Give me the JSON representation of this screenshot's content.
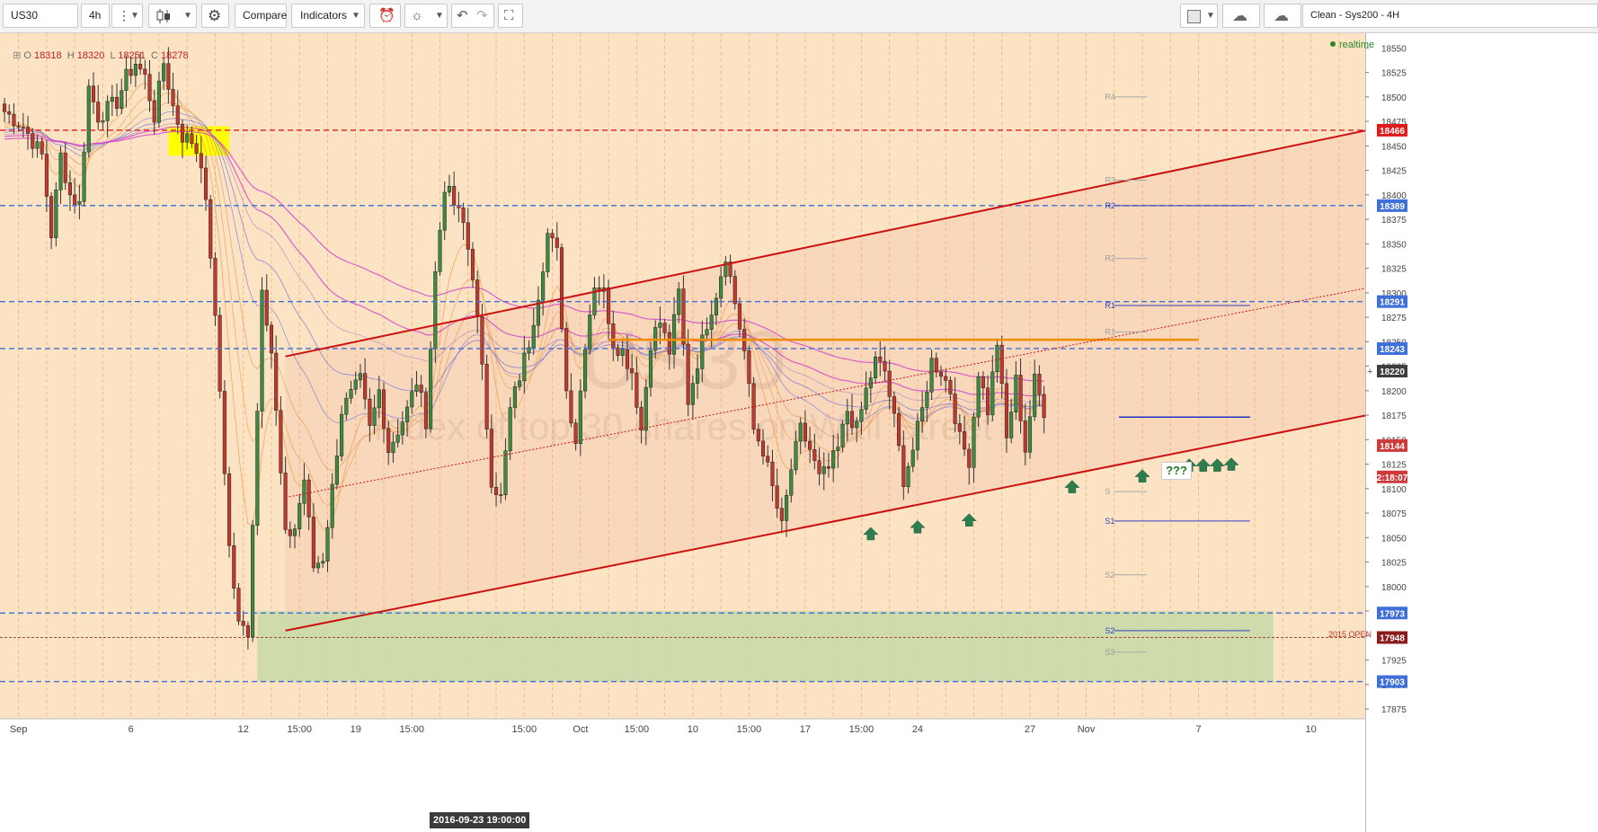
{
  "toolbar": {
    "symbol": "US30",
    "interval": "4h",
    "compare_label": "Compare",
    "indicators_label": "Indicators",
    "template_label": "Clean - Sys200 - 4H",
    "icons": [
      "menu-dots-icon",
      "candlestick-icon",
      "gear-icon",
      "alert-icon",
      "lightbulb-icon",
      "undo-icon",
      "redo-icon",
      "fullscreen-icon",
      "rectangle-icon",
      "cloud-down-icon",
      "cloud-up-icon"
    ]
  },
  "legend": {
    "o_label": "O",
    "o": "18318",
    "h_label": "H",
    "h": "18320",
    "l_label": "L",
    "l": "18251",
    "c_label": "C",
    "c": "18278"
  },
  "status": {
    "realtime": "realtime"
  },
  "watermark": {
    "title": "US30",
    "subtitle": "Index of top 30 shares on Wall Street"
  },
  "price_axis": {
    "ticks": [
      "18550",
      "18525",
      "18500",
      "18475",
      "18450",
      "18425",
      "18400",
      "18375",
      "18350",
      "18325",
      "18300",
      "18275",
      "18250",
      "18225",
      "18200",
      "18175",
      "18150",
      "18125",
      "18100",
      "18075",
      "18050",
      "18025",
      "18000",
      "17975",
      "17950",
      "17925",
      "17900",
      "17875"
    ],
    "badges": [
      {
        "price": 18466,
        "label": "18466",
        "color": "#e01b1b"
      },
      {
        "price": 18389,
        "label": "18389",
        "color": "#3f6fd8"
      },
      {
        "price": 18291,
        "label": "18291",
        "color": "#3f6fd8"
      },
      {
        "price": 18243,
        "label": "18243",
        "color": "#3f6fd8"
      },
      {
        "price": 18220,
        "label": "18220",
        "color": "#3d3d3d"
      },
      {
        "price": 18144,
        "label": "18144",
        "color": "#cf3a3a"
      },
      {
        "price": 18112,
        "label": "2:18:07",
        "color": "#cf3a3a"
      },
      {
        "price": 17973,
        "label": "17973",
        "color": "#3f6fd8"
      },
      {
        "price": 17948,
        "label": "17948",
        "color": "#8b1a1a"
      },
      {
        "price": 17903,
        "label": "17903",
        "color": "#3f6fd8"
      }
    ]
  },
  "time_axis": {
    "labels": [
      {
        "bar": 3,
        "label": "Sep"
      },
      {
        "bar": 27,
        "label": "6"
      },
      {
        "bar": 51,
        "label": "12"
      },
      {
        "bar": 63,
        "label": "15:00"
      },
      {
        "bar": 75,
        "label": "19"
      },
      {
        "bar": 87,
        "label": "15:00"
      },
      {
        "bar": 111,
        "label": "15:00"
      },
      {
        "bar": 123,
        "label": "Oct"
      },
      {
        "bar": 135,
        "label": "15:00"
      },
      {
        "bar": 147,
        "label": "10"
      },
      {
        "bar": 159,
        "label": "15:00"
      },
      {
        "bar": 171,
        "label": "17"
      },
      {
        "bar": 183,
        "label": "15:00"
      },
      {
        "bar": 195,
        "label": "24"
      },
      {
        "bar": 219,
        "label": "27"
      },
      {
        "bar": 231,
        "label": "Nov"
      },
      {
        "bar": 255,
        "label": "7"
      },
      {
        "bar": 279,
        "label": "10"
      }
    ],
    "cursor_label": "2016-09-23 19:00:00"
  },
  "annotations": {
    "question_marks": "???",
    "open_2015": "2015 OPEN",
    "pivots": [
      {
        "label": "R4",
        "price": 18500
      },
      {
        "label": "R3",
        "price": 18415
      },
      {
        "label": "R2",
        "price": 18389
      },
      {
        "label": "R2",
        "price": 18335
      },
      {
        "label": "R1",
        "price": 18287
      },
      {
        "label": "R1",
        "price": 18260
      },
      {
        "label": "S",
        "price": 18097
      },
      {
        "label": "S1",
        "price": 18067
      },
      {
        "label": "S2",
        "price": 18012
      },
      {
        "label": "S2",
        "price": 17955
      },
      {
        "label": "S3",
        "price": 17933
      }
    ]
  },
  "colors": {
    "chart_bg": "#fce3c4",
    "up": "#3d8c3d",
    "down": "#c0392b",
    "channel": "#cc1111",
    "support_zone": "#c8d9a8",
    "level_blue": "#3f6fd8",
    "level_red": "#e01b1b",
    "arrow": "#2e7d4f"
  },
  "chart_data": {
    "type": "candlestick",
    "symbol": "US30",
    "interval": "4h",
    "ylim": [
      17865,
      18565
    ],
    "xlim": [
      0,
      291
    ],
    "last": {
      "open": 18318,
      "high": 18320,
      "low": 18251,
      "close": 18278
    },
    "anchors": [
      [
        0,
        18485
      ],
      [
        4,
        18470
      ],
      [
        8,
        18440
      ],
      [
        10,
        18360
      ],
      [
        12,
        18440
      ],
      [
        14,
        18400
      ],
      [
        16,
        18390
      ],
      [
        18,
        18510
      ],
      [
        20,
        18480
      ],
      [
        24,
        18495
      ],
      [
        26,
        18520
      ],
      [
        28,
        18535
      ],
      [
        30,
        18520
      ],
      [
        32,
        18480
      ],
      [
        34,
        18535
      ],
      [
        36,
        18490
      ],
      [
        38,
        18460
      ],
      [
        40,
        18455
      ],
      [
        42,
        18435
      ],
      [
        44,
        18340
      ],
      [
        46,
        18200
      ],
      [
        48,
        18040
      ],
      [
        50,
        17960
      ],
      [
        52,
        17955
      ],
      [
        54,
        18180
      ],
      [
        55,
        18310
      ],
      [
        57,
        18240
      ],
      [
        60,
        18050
      ],
      [
        62,
        18060
      ],
      [
        64,
        18110
      ],
      [
        66,
        18020
      ],
      [
        68,
        18030
      ],
      [
        70,
        18100
      ],
      [
        72,
        18180
      ],
      [
        76,
        18210
      ],
      [
        78,
        18160
      ],
      [
        80,
        18200
      ],
      [
        82,
        18140
      ],
      [
        86,
        18180
      ],
      [
        88,
        18210
      ],
      [
        90,
        18170
      ],
      [
        92,
        18320
      ],
      [
        94,
        18410
      ],
      [
        96,
        18390
      ],
      [
        98,
        18370
      ],
      [
        100,
        18320
      ],
      [
        102,
        18220
      ],
      [
        104,
        18110
      ],
      [
        106,
        18090
      ],
      [
        108,
        18180
      ],
      [
        112,
        18250
      ],
      [
        114,
        18300
      ],
      [
        116,
        18360
      ],
      [
        118,
        18340
      ],
      [
        120,
        18200
      ],
      [
        122,
        18150
      ],
      [
        124,
        18250
      ],
      [
        126,
        18310
      ],
      [
        128,
        18300
      ],
      [
        130,
        18250
      ],
      [
        132,
        18240
      ],
      [
        134,
        18220
      ],
      [
        136,
        18160
      ],
      [
        138,
        18250
      ],
      [
        140,
        18270
      ],
      [
        142,
        18240
      ],
      [
        144,
        18300
      ],
      [
        146,
        18190
      ],
      [
        148,
        18230
      ],
      [
        150,
        18270
      ],
      [
        152,
        18300
      ],
      [
        154,
        18340
      ],
      [
        156,
        18290
      ],
      [
        158,
        18240
      ],
      [
        160,
        18160
      ],
      [
        162,
        18140
      ],
      [
        164,
        18100
      ],
      [
        166,
        18060
      ],
      [
        168,
        18120
      ],
      [
        170,
        18160
      ],
      [
        172,
        18140
      ],
      [
        174,
        18110
      ],
      [
        176,
        18120
      ],
      [
        178,
        18140
      ],
      [
        180,
        18180
      ],
      [
        182,
        18160
      ],
      [
        184,
        18200
      ],
      [
        186,
        18230
      ],
      [
        188,
        18220
      ],
      [
        190,
        18170
      ],
      [
        192,
        18110
      ],
      [
        194,
        18140
      ],
      [
        196,
        18180
      ],
      [
        198,
        18230
      ],
      [
        200,
        18220
      ],
      [
        202,
        18200
      ],
      [
        204,
        18150
      ],
      [
        206,
        18130
      ],
      [
        208,
        18220
      ],
      [
        210,
        18180
      ],
      [
        212,
        18250
      ],
      [
        214,
        18150
      ],
      [
        216,
        18210
      ],
      [
        218,
        18140
      ],
      [
        220,
        18210
      ],
      [
        222,
        18180
      ]
    ],
    "levels": [
      {
        "price": 18466,
        "style": "dashed",
        "color": "red"
      },
      {
        "price": 18389,
        "style": "dashed",
        "color": "blue"
      },
      {
        "price": 18291,
        "style": "dashed",
        "color": "blue"
      },
      {
        "price": 18243,
        "style": "dashed",
        "color": "blue"
      },
      {
        "price": 17973,
        "style": "dashed",
        "color": "blue"
      },
      {
        "price": 17903,
        "style": "dashed",
        "color": "blue"
      },
      {
        "price": 17948,
        "style": "dashed",
        "color": "darkred"
      },
      {
        "price": 18252,
        "style": "solid",
        "color": "orange"
      }
    ],
    "channel": {
      "upper": [
        [
          60,
          18235
        ],
        [
          291,
          18466
        ]
      ],
      "lower": [
        [
          60,
          17955
        ],
        [
          291,
          18175
        ]
      ],
      "mid_dotted": [
        [
          60,
          18091
        ],
        [
          291,
          18305
        ]
      ]
    },
    "support_zone": [
      17903,
      17975
    ],
    "up_arrows": [
      [
        185,
        18055
      ],
      [
        195,
        18062
      ],
      [
        206,
        18069
      ],
      [
        228,
        18103
      ],
      [
        243,
        18114
      ],
      [
        253,
        18125
      ],
      [
        256,
        18125
      ],
      [
        259,
        18125
      ],
      [
        262,
        18126
      ]
    ]
  }
}
